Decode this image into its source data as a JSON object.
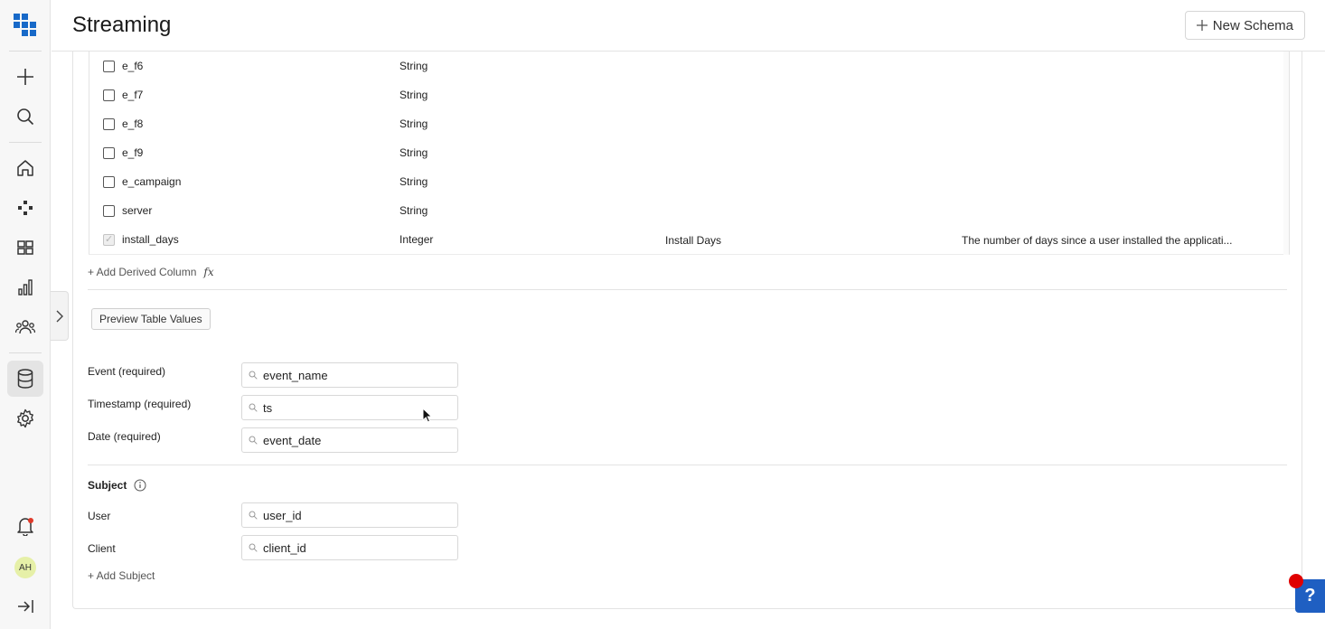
{
  "header": {
    "title": "Streaming",
    "new_schema_label": "New Schema"
  },
  "sidebar": {
    "items": [
      {
        "icon": "logo-icon"
      },
      {
        "icon": "plus-icon"
      },
      {
        "icon": "search-icon"
      },
      {
        "icon": "home-icon"
      },
      {
        "icon": "connectors-icon"
      },
      {
        "icon": "dashboard-icon"
      },
      {
        "icon": "bar-chart-icon"
      },
      {
        "icon": "users-icon"
      },
      {
        "icon": "database-icon",
        "active": true
      },
      {
        "icon": "gear-icon"
      },
      {
        "icon": "bell-icon"
      },
      {
        "icon": "avatar"
      },
      {
        "icon": "collapse-icon"
      }
    ],
    "avatar_initials": "AH"
  },
  "table": {
    "rows": [
      {
        "name": "e_f6",
        "type": "String",
        "display": "",
        "description": "",
        "checked": false
      },
      {
        "name": "e_f7",
        "type": "String",
        "display": "",
        "description": "",
        "checked": false
      },
      {
        "name": "e_f8",
        "type": "String",
        "display": "",
        "description": "",
        "checked": false
      },
      {
        "name": "e_f9",
        "type": "String",
        "display": "",
        "description": "",
        "checked": false
      },
      {
        "name": "e_campaign",
        "type": "String",
        "display": "",
        "description": "",
        "checked": false
      },
      {
        "name": "server",
        "type": "String",
        "display": "",
        "description": "",
        "checked": false
      },
      {
        "name": "install_days",
        "type": "Integer",
        "display": "Install Days",
        "description": "The number of days since a user installed the applicati...",
        "checked": true
      }
    ],
    "add_derived_label": "+ Add Derived Column",
    "fx_symbol": "fx"
  },
  "preview_label": "Preview Table Values",
  "fields": {
    "event": {
      "label": "Event (required)",
      "value": "event_name"
    },
    "timestamp": {
      "label": "Timestamp (required)",
      "value": "ts"
    },
    "date": {
      "label": "Date (required)",
      "value": "event_date"
    }
  },
  "subject": {
    "heading": "Subject",
    "user": {
      "label": "User",
      "value": "user_id"
    },
    "client": {
      "label": "Client",
      "value": "client_id"
    },
    "add_label": "+ Add Subject"
  },
  "help_label": "?",
  "colors": {
    "accent": "#1f5fc2",
    "logo": "#1769c8",
    "alert": "#e00000"
  }
}
